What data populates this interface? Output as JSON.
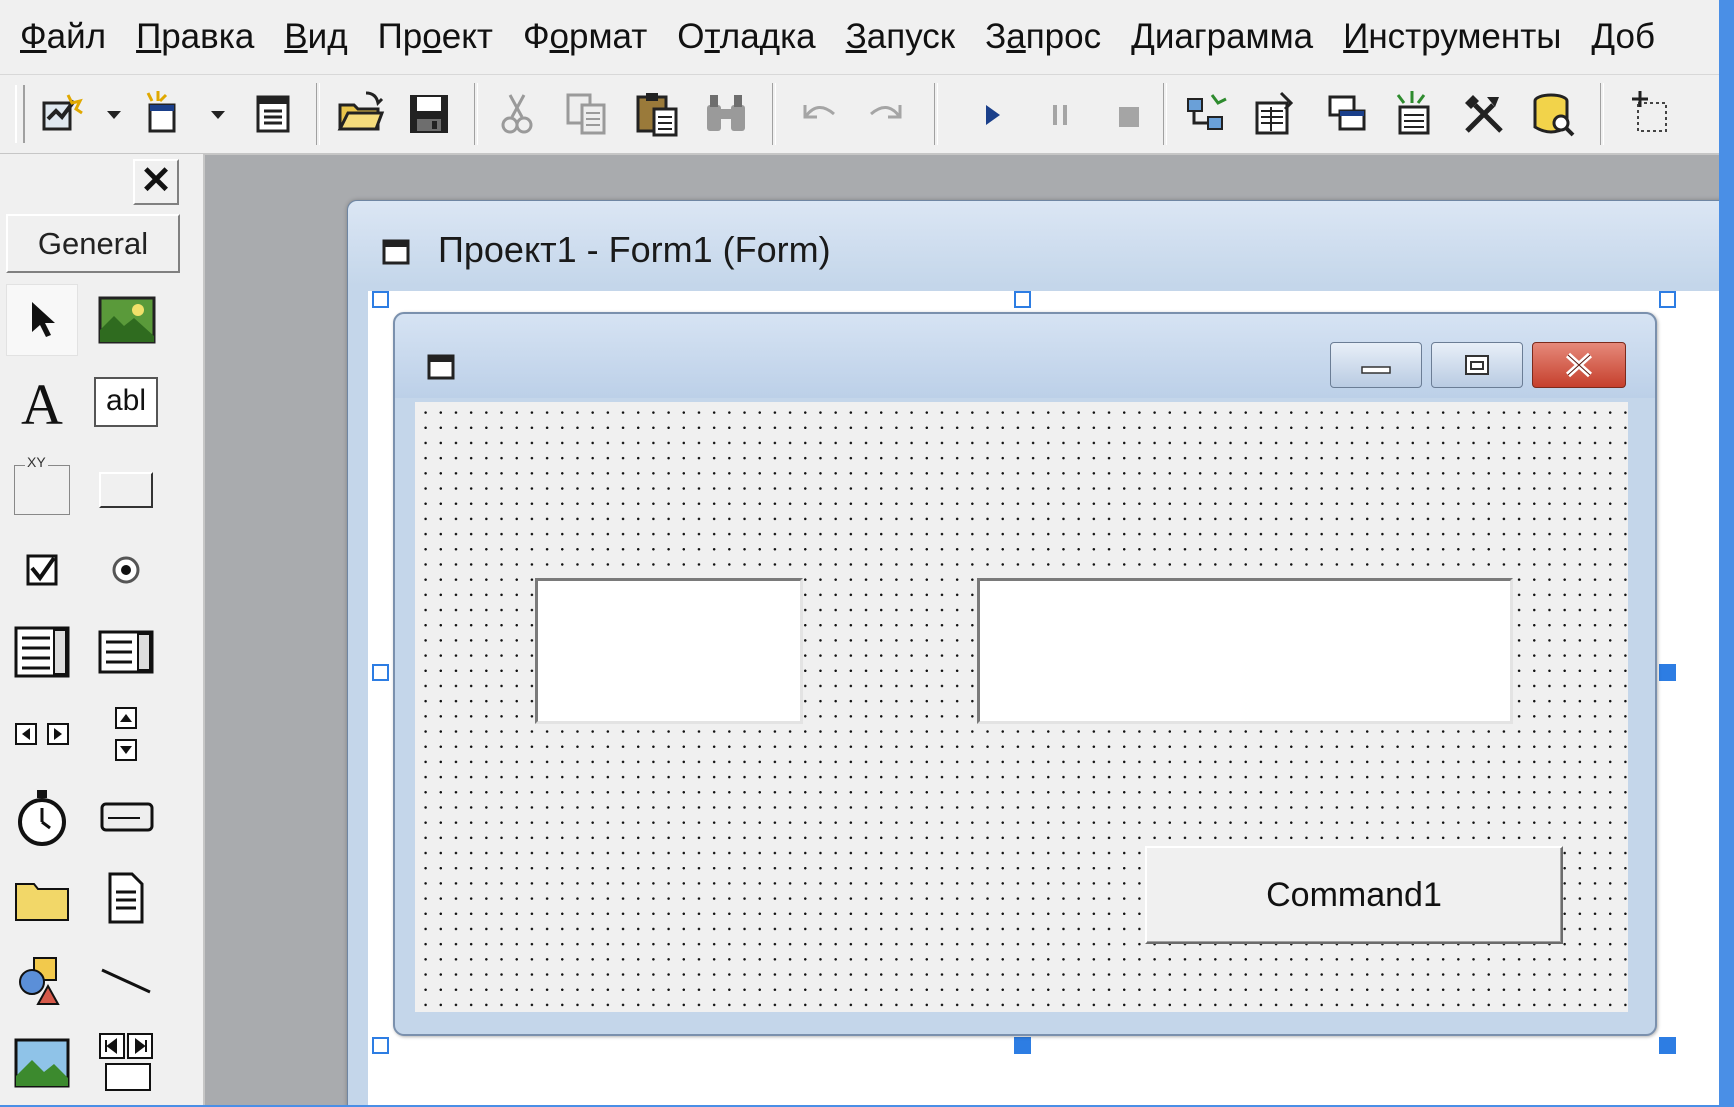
{
  "menu": [
    {
      "pre": "",
      "u": "Ф",
      "post": "айл"
    },
    {
      "pre": "",
      "u": "П",
      "post": "равка"
    },
    {
      "pre": "",
      "u": "В",
      "post": "ид"
    },
    {
      "pre": "Пр",
      "u": "о",
      "post": "ект"
    },
    {
      "pre": "Ф",
      "u": "о",
      "post": "рмат"
    },
    {
      "pre": "О",
      "u": "т",
      "post": "ладка"
    },
    {
      "pre": "",
      "u": "З",
      "post": "апуск"
    },
    {
      "pre": "З",
      "u": "а",
      "post": "прос"
    },
    {
      "pre": "",
      "u": "Д",
      "post": "иаграмма"
    },
    {
      "pre": "",
      "u": "И",
      "post": "нструменты"
    },
    {
      "pre": "",
      "u": "Д",
      "post": "об"
    }
  ],
  "toolbox": {
    "tab_label": "General",
    "close_glyph": "✕",
    "textbox_tool_text": "abl",
    "frame_tool_text": "XY"
  },
  "designer": {
    "title": "Проект1 - Form1 (Form)"
  },
  "form": {
    "command_button_label": "Command1"
  },
  "colors": {
    "accent": "#2d7de3",
    "desktop": "#4a8fe6",
    "mdi_background": "#a9abae",
    "close_button": "#c6402d"
  }
}
